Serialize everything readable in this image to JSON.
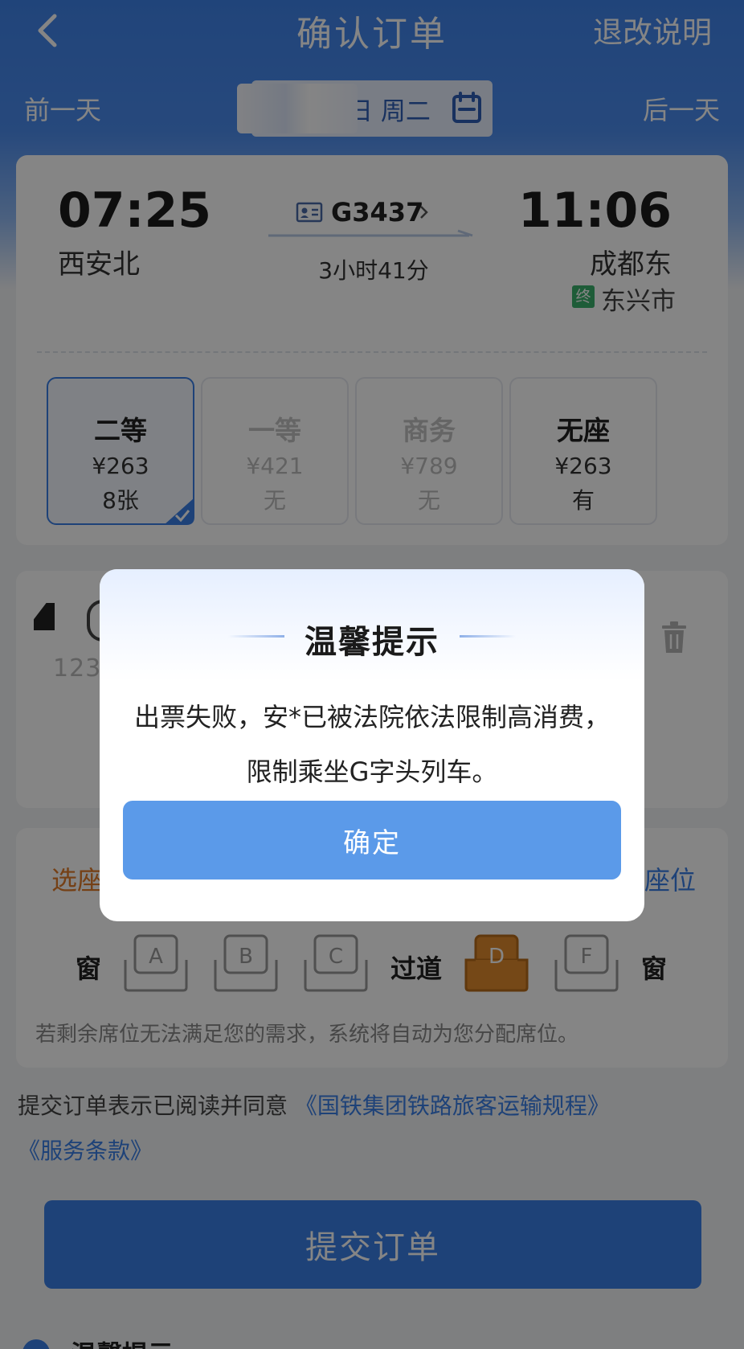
{
  "header": {
    "title": "确认订单",
    "refund_link": "退改说明",
    "prev_day": "前一天",
    "next_day": "后一天",
    "date_label": "日 周二"
  },
  "train": {
    "departure_time": "07:25",
    "arrival_time": "11:06",
    "departure_station": "西安北",
    "arrival_station": "成都东",
    "train_number": "G3437",
    "duration": "3小时41分",
    "terminal_badge": "终",
    "terminal_station": "东兴市"
  },
  "seat_classes": [
    {
      "name": "二等",
      "price": "¥263",
      "remaining": "8张",
      "selected": true,
      "available": true
    },
    {
      "name": "一等",
      "price": "¥421",
      "remaining": "无",
      "selected": false,
      "available": false
    },
    {
      "name": "商务",
      "price": "¥789",
      "remaining": "无",
      "selected": false,
      "available": false
    },
    {
      "name": "无座",
      "price": "¥263",
      "remaining": "有",
      "selected": false,
      "available": true
    }
  ],
  "passenger": {
    "id_partial": "123"
  },
  "seat_select": {
    "title": "选座",
    "right_label": "座位",
    "window_left": "窗",
    "aisle": "过道",
    "window_right": "窗",
    "seats": [
      "A",
      "B",
      "C",
      "D",
      "F"
    ],
    "selected_seat": "D",
    "note": "若剩余席位无法满足您的需求，系统将自动为您分配席位。"
  },
  "agreement": {
    "prefix": "提交订单表示已阅读并同意 ",
    "link1": "《国铁集团铁路旅客运输规程》",
    "link2": "《服务条款》"
  },
  "submit_label": "提交订单",
  "tip_label": "温馨提示",
  "dialog": {
    "title": "温馨提示",
    "line1": "出票失败，安*已被法院依法限制高消费，",
    "line2": "限制乘坐G字头列车。",
    "confirm_label": "确定"
  },
  "colors": {
    "primary": "#3a7fe6",
    "seat_selected": "#e08a2c",
    "accent_orange": "#e07b2a",
    "badge_green": "#3ab16b"
  }
}
